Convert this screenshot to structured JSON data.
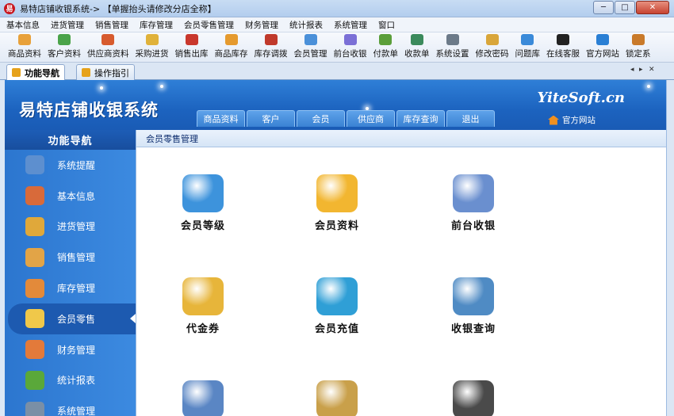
{
  "window": {
    "title": "易特店铺收银系统-> 【单握抬头请修改分店全称】",
    "app_icon": "易",
    "controls": {
      "minimize": "─",
      "maximize": "□",
      "close": "✕"
    }
  },
  "menu": [
    "基本信息",
    "进货管理",
    "销售管理",
    "库存管理",
    "会员零售管理",
    "财务管理",
    "统计报表",
    "系统管理",
    "窗口"
  ],
  "toolbar": [
    {
      "label": "商品资料",
      "icon": "product-icon",
      "color": "#e8a13a"
    },
    {
      "label": "客户资料",
      "icon": "customer-icon",
      "color": "#4aa34a"
    },
    {
      "label": "供应商资料",
      "icon": "supplier-icon",
      "color": "#d75b2e"
    },
    {
      "label": "采购进货",
      "icon": "purchase-icon",
      "color": "#e0b23a"
    },
    {
      "label": "销售出库",
      "icon": "sale-icon",
      "color": "#c9372c"
    },
    {
      "label": "商品库存",
      "icon": "stock-icon",
      "color": "#e59a2e"
    },
    {
      "label": "库存调拨",
      "icon": "transfer-icon",
      "color": "#c0392b"
    },
    {
      "label": "会员管理",
      "icon": "member-icon",
      "color": "#4a90d9"
    },
    {
      "label": "前台收银",
      "icon": "pos-icon",
      "color": "#7a6fd6"
    },
    {
      "label": "付款单",
      "icon": "payment-icon",
      "color": "#5a9e3a"
    },
    {
      "label": "收款单",
      "icon": "receipt-icon",
      "color": "#3b8a5c"
    },
    {
      "label": "系统设置",
      "icon": "settings-icon",
      "color": "#6c7a89"
    },
    {
      "label": "修改密码",
      "icon": "password-icon",
      "color": "#d9a63a"
    },
    {
      "label": "问题库",
      "icon": "faq-icon",
      "color": "#3a8ad9"
    },
    {
      "label": "在线客服",
      "icon": "qq-icon",
      "color": "#222222"
    },
    {
      "label": "官方网站",
      "icon": "ie-icon",
      "color": "#2a7fd4"
    },
    {
      "label": "锁定系",
      "icon": "lock-icon",
      "color": "#c97a2a"
    }
  ],
  "tabs": [
    {
      "label": "功能导航",
      "active": true
    },
    {
      "label": "操作指引",
      "active": false
    }
  ],
  "tab_controls": {
    "prev": "◂",
    "next": "▸",
    "close": "✕"
  },
  "banner": {
    "title": "易特店铺收银系统",
    "brand": "YiteSoft.cn",
    "tabs": [
      "商品资料",
      "客户",
      "会员",
      "供应商",
      "库存查询",
      "退出"
    ],
    "official_link": "官方网站"
  },
  "sidebar": {
    "header": "功能导航",
    "items": [
      {
        "label": "系统提醒",
        "icon": "info-icon",
        "color": "#5d8fcf",
        "active": false
      },
      {
        "label": "基本信息",
        "icon": "cubes-icon",
        "color": "#d86a3a",
        "active": false
      },
      {
        "label": "进货管理",
        "icon": "box-in-icon",
        "color": "#e0a83a",
        "active": false
      },
      {
        "label": "销售管理",
        "icon": "box-out-icon",
        "color": "#e2a447",
        "active": false
      },
      {
        "label": "库存管理",
        "icon": "warehouse-icon",
        "color": "#e38a3a",
        "active": false
      },
      {
        "label": "会员零售",
        "icon": "chat-member-icon",
        "color": "#f0c84a",
        "active": true
      },
      {
        "label": "财务管理",
        "icon": "finance-icon",
        "color": "#e37a3a",
        "active": false
      },
      {
        "label": "统计报表",
        "icon": "chart-icon",
        "color": "#5aa83a",
        "active": false
      },
      {
        "label": "系统管理",
        "icon": "tools-icon",
        "color": "#7a8fa6",
        "active": false
      }
    ]
  },
  "content": {
    "breadcrumb": "会员零售管理",
    "items": [
      {
        "label": "会员等级",
        "icon": "member-level-icon",
        "color": "#3d93dc"
      },
      {
        "label": "会员资料",
        "icon": "member-profile-icon",
        "color": "#f2b630"
      },
      {
        "label": "前台收银",
        "icon": "cashier-icon",
        "color": "#6a8fcf"
      },
      {
        "label": "代金券",
        "icon": "voucher-icon",
        "color": "#e7b53a"
      },
      {
        "label": "会员充值",
        "icon": "recharge-icon",
        "color": "#2f9fd6"
      },
      {
        "label": "收银查询",
        "icon": "cash-query-icon",
        "color": "#4f8bc4"
      },
      {
        "label": "",
        "icon": "person-laptop-icon",
        "color": "#5a86c4"
      },
      {
        "label": "",
        "icon": "money-bag-icon",
        "color": "#c9a04a"
      },
      {
        "label": "",
        "icon": "users-icon",
        "color": "#4a4a4a"
      }
    ]
  }
}
